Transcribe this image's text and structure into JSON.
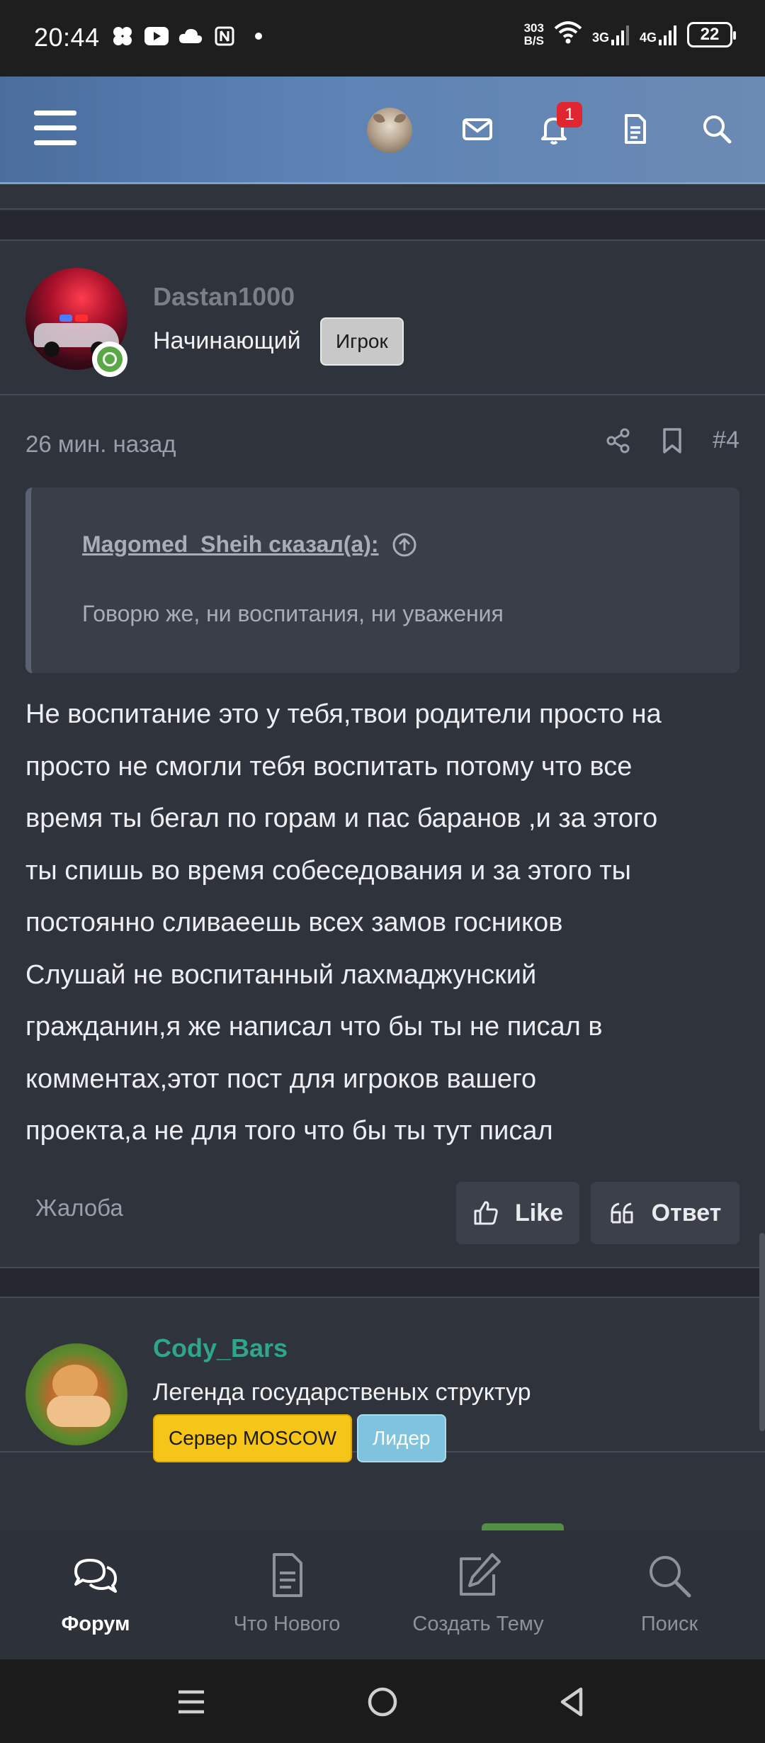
{
  "status_bar": {
    "time": "20:44",
    "speed_value": "303",
    "speed_unit": "B/S",
    "net1": "3G",
    "net2": "4G",
    "battery": "22"
  },
  "header": {
    "notification_count": "1"
  },
  "posts": [
    {
      "author": "Dastan1000",
      "author_color": "#7b7f86",
      "user_title": "Начинающий",
      "badges": [
        {
          "label": "Игрок",
          "bg": "#c8c8c8",
          "fg": "#1a1a1a"
        }
      ],
      "time": "26 мин. назад",
      "number": "#4",
      "quote": {
        "author_line": "Magomed_Sheih сказал(а):",
        "text": "Говорю же, ни воспитания, ни уважения"
      },
      "body_lines": [
        "Не воспитание это у тебя,твои родители просто на",
        "просто не смогли тебя воспитать потому что все",
        "время ты бегал по горам и пас баранов ,и за этого",
        "ты спишь во время собеседования и за этого ты",
        "постоянно сливаеешь всех замов госников",
        "Слушай не воспитанный лахмаджунский",
        "гражданин,я же написал что бы ты не писал в",
        "комментах,этот пост для игроков вашего",
        "проекта,а не для того что бы ты тут писал"
      ],
      "report": "Жалоба",
      "like": "Like",
      "reply": "Ответ"
    },
    {
      "author": "Cody_Bars",
      "author_color": "#2fa58a",
      "user_title": "Легенда государственых структур",
      "badges": [
        {
          "label": "Сервер MOSCOW",
          "bg": "#f5c518",
          "fg": "#1a1a1a"
        },
        {
          "label": "Лидер",
          "bg": "#7fc3df",
          "fg": "#ffffff"
        }
      ]
    }
  ],
  "bottom_nav": [
    {
      "label": "Форум",
      "icon": "chat-bubbles-icon",
      "active": true
    },
    {
      "label": "Что Нового",
      "icon": "document-icon",
      "active": false
    },
    {
      "label": "Создать Тему",
      "icon": "edit-icon",
      "active": false
    },
    {
      "label": "Поиск",
      "icon": "search-icon",
      "active": false
    }
  ]
}
